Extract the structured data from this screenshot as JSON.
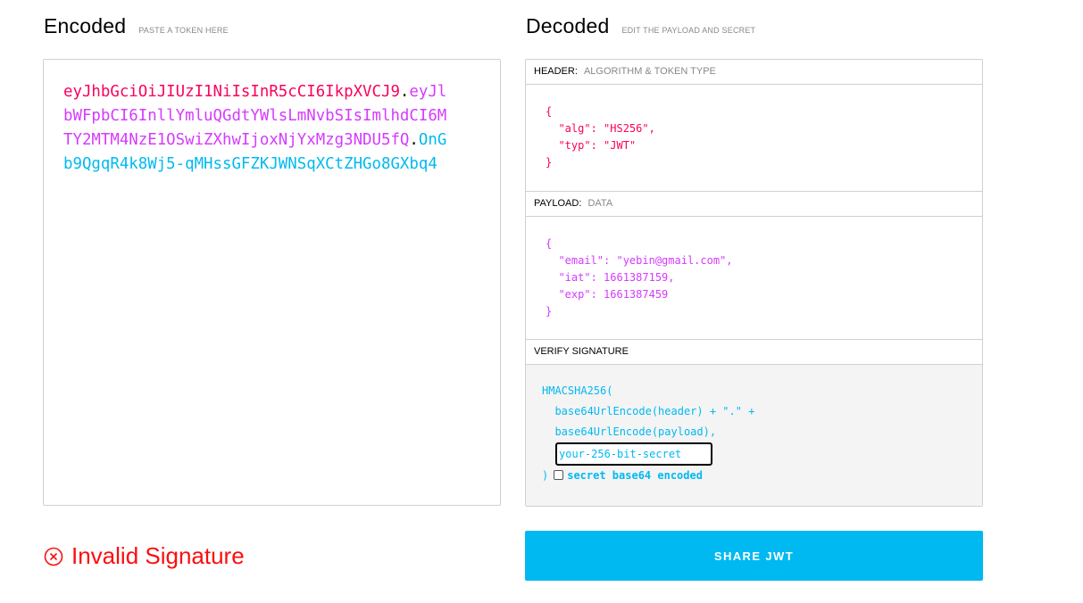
{
  "encoded": {
    "title": "Encoded",
    "subtitle": "PASTE A TOKEN HERE",
    "token_header": "eyJhbGciOiJIUzI1NiIsInR5cCI6IkpXVCJ9",
    "token_payload": "eyJlbWFpbCI6InllYmluQGdtYWlsLmNvbSIsImlhdCI6MTY2MTM4NzE1OSwiZXhwIjoxNjYxMzg3NDU5fQ",
    "token_signature": "OnGb9QgqR4k8Wj5-qMHssGFZKJWNSqXCtZHGo8GXbq4",
    "dot": "."
  },
  "decoded": {
    "title": "Decoded",
    "subtitle": "EDIT THE PAYLOAD AND SECRET",
    "header_label": "HEADER:",
    "header_sub": "ALGORITHM & TOKEN TYPE",
    "header_json": "{\n  \"alg\": \"HS256\",\n  \"typ\": \"JWT\"\n}",
    "payload_label": "PAYLOAD:",
    "payload_sub": "DATA",
    "payload_json": "{\n  \"email\": \"yebin@gmail.com\",\n  \"iat\": 1661387159,\n  \"exp\": 1661387459\n}",
    "verify_label": "VERIFY SIGNATURE",
    "verify_line1": "HMACSHA256(",
    "verify_line2": "  base64UrlEncode(header) + \".\" +",
    "verify_line3": "  base64UrlEncode(payload),",
    "secret_value": "your-256-bit-secret",
    "closing_paren": ")",
    "base64_label": "secret base64 encoded",
    "base64_checked": false
  },
  "status": {
    "text": "Invalid Signature",
    "color": "#fb0e0e"
  },
  "share_button": {
    "label": "SHARE JWT",
    "color": "#00b9f1"
  },
  "colors": {
    "header": "#fb015b",
    "payload": "#d63aff",
    "signature": "#00b9f1"
  }
}
